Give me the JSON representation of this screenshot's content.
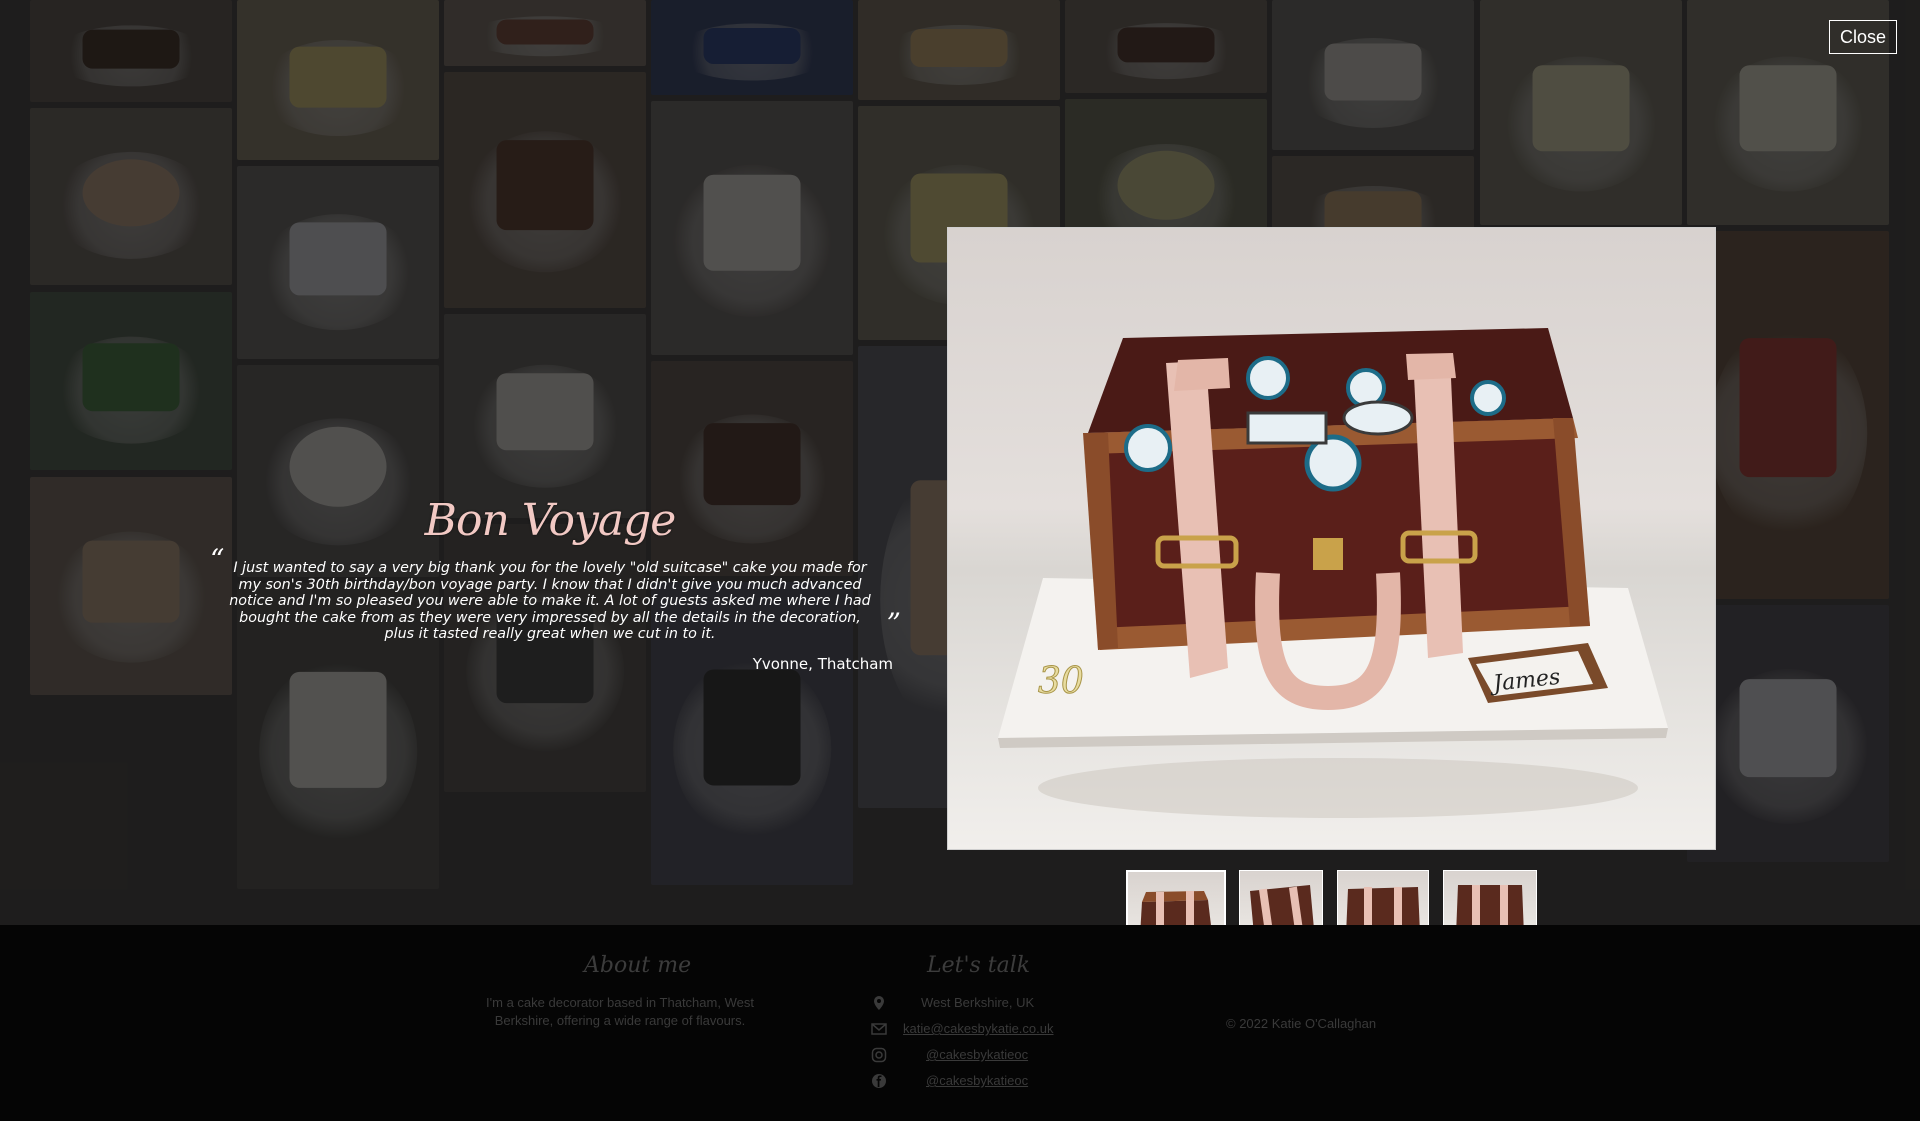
{
  "modal": {
    "close_label": "Close",
    "photo_name_tag": "James",
    "photo_number": "30"
  },
  "testimonial": {
    "title": "Bon Voyage",
    "open_quote": "“",
    "quote": "I just wanted to say a very big thank you for the lovely \"old suitcase\" cake you made for my son's 30th birthday/bon voyage party. I know that I didn't give you much advanced notice and I'm so pleased you were able to make it. A lot of guests asked me where I had bought the cake from as they were very impressed by all the details in the decoration, plus it tasted really great when we cut in to it.",
    "close_quote": "”",
    "author": "Yvonne, Thatcham"
  },
  "footer": {
    "about_heading": "About me",
    "about_text": "I'm a cake decorator based in Thatcham, West Berkshire, offering a wide range of flavours.",
    "contact_heading": "Let's talk",
    "location": "West Berkshire, UK",
    "email": "katie@cakesbykatie.co.uk",
    "instagram": "@cakesbykatieoc",
    "facebook": "@cakesbykatieoc",
    "copyright": "© 2022 Katie O'Callaghan",
    "icons": [
      "location-pin-icon",
      "envelope-icon",
      "instagram-icon",
      "facebook-icon"
    ]
  }
}
